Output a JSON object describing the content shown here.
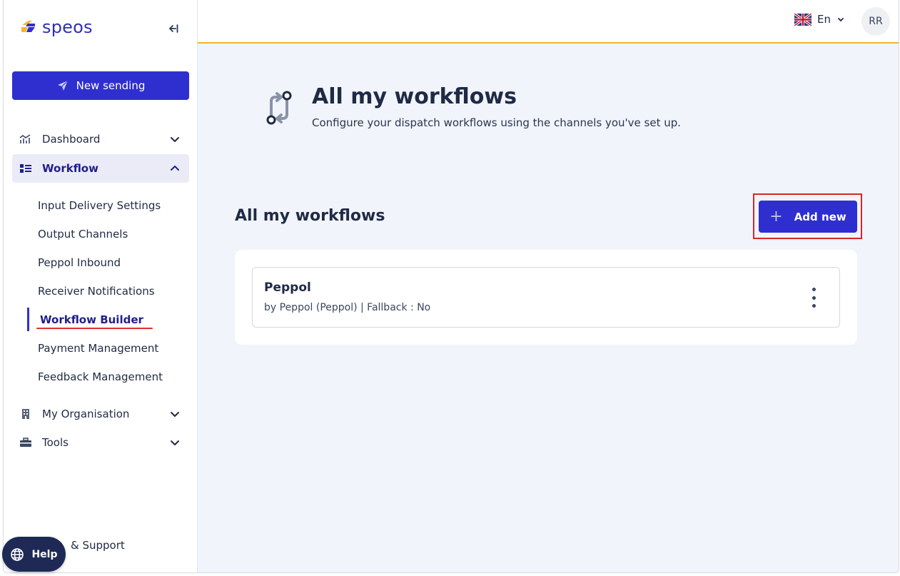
{
  "brand": {
    "name": "speos",
    "color": "#2f2fb8"
  },
  "sidebar": {
    "new_sending_label": "New sending",
    "items": [
      {
        "label": "Dashboard",
        "icon": "chart-icon",
        "expanded": false
      },
      {
        "label": "Workflow",
        "icon": "workflow-icon",
        "expanded": true,
        "active": true
      },
      {
        "label": "My Organisation",
        "icon": "building-icon",
        "expanded": false
      },
      {
        "label": "Tools",
        "icon": "toolbox-icon",
        "expanded": false
      }
    ],
    "workflow_subitems": [
      {
        "label": "Input Delivery Settings"
      },
      {
        "label": "Output Channels"
      },
      {
        "label": "Peppol Inbound"
      },
      {
        "label": "Receiver Notifications"
      },
      {
        "label": "Workflow Builder",
        "active": true
      },
      {
        "label": "Payment Management"
      },
      {
        "label": "Feedback Management"
      }
    ],
    "help_support_label": "& Support",
    "help_button_label": "Help"
  },
  "topbar": {
    "language": "En",
    "avatar_initials": "RR",
    "accent_color": "#f2b62b"
  },
  "page": {
    "title": "All my workflows",
    "subtitle": "Configure your dispatch workflows using the channels you've set up.",
    "section_title": "All my workflows",
    "add_new_label": "Add new"
  },
  "workflows": [
    {
      "name": "Peppol",
      "details": "by Peppol (Peppol) | Fallback : No"
    }
  ],
  "colors": {
    "primary": "#2f2fcf",
    "highlight": "#d6262a"
  }
}
